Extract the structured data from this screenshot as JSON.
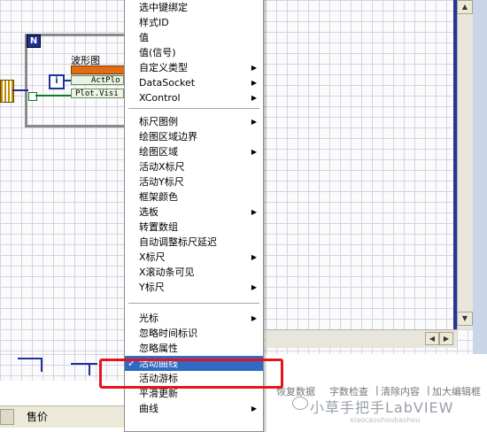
{
  "diagram": {
    "structure_label": "N",
    "waveform_label": "波形图",
    "index_icon_label": "i",
    "property_active_plot": "ActPlo",
    "property_visible": "Plot.Visi"
  },
  "context_menu": {
    "items": [
      {
        "label": "选中键绑定",
        "submenu": false,
        "checked": false,
        "highlighted": false
      },
      {
        "label": "样式ID",
        "submenu": false,
        "checked": false,
        "highlighted": false
      },
      {
        "label": "值",
        "submenu": false,
        "checked": false,
        "highlighted": false
      },
      {
        "label": "值(信号)",
        "submenu": false,
        "checked": false,
        "highlighted": false
      },
      {
        "label": "自定义类型",
        "submenu": true,
        "checked": false,
        "highlighted": false
      },
      {
        "label": "DataSocket",
        "submenu": true,
        "checked": false,
        "highlighted": false
      },
      {
        "label": "XControl",
        "submenu": true,
        "checked": false,
        "highlighted": false
      },
      {
        "label": "标尺图例",
        "submenu": true,
        "checked": false,
        "highlighted": false
      },
      {
        "label": "绘图区域边界",
        "submenu": false,
        "checked": false,
        "highlighted": false
      },
      {
        "label": "绘图区域",
        "submenu": true,
        "checked": false,
        "highlighted": false
      },
      {
        "label": "活动X标尺",
        "submenu": false,
        "checked": false,
        "highlighted": false
      },
      {
        "label": "活动Y标尺",
        "submenu": false,
        "checked": false,
        "highlighted": false
      },
      {
        "label": "框架颜色",
        "submenu": false,
        "checked": false,
        "highlighted": false
      },
      {
        "label": "选板",
        "submenu": true,
        "checked": false,
        "highlighted": false
      },
      {
        "label": "转置数组",
        "submenu": false,
        "checked": false,
        "highlighted": false
      },
      {
        "label": "自动调整标尺延迟",
        "submenu": false,
        "checked": false,
        "highlighted": false
      },
      {
        "label": "X标尺",
        "submenu": true,
        "checked": false,
        "highlighted": false
      },
      {
        "label": "X滚动条可见",
        "submenu": false,
        "checked": false,
        "highlighted": false
      },
      {
        "label": "Y标尺",
        "submenu": true,
        "checked": false,
        "highlighted": false
      },
      {
        "label": "光标",
        "submenu": true,
        "checked": false,
        "highlighted": false
      },
      {
        "label": "忽略时间标识",
        "submenu": false,
        "checked": false,
        "highlighted": false
      },
      {
        "label": "忽略属性",
        "submenu": false,
        "checked": false,
        "highlighted": false
      },
      {
        "label": "活动曲线",
        "submenu": false,
        "checked": true,
        "highlighted": true
      },
      {
        "label": "活动游标",
        "submenu": false,
        "checked": false,
        "highlighted": false
      },
      {
        "label": "平滑更新",
        "submenu": false,
        "checked": false,
        "highlighted": false
      },
      {
        "label": "曲线",
        "submenu": true,
        "checked": false,
        "highlighted": false
      }
    ],
    "arrow_glyph": "▶",
    "check_glyph": "✓"
  },
  "bottom": {
    "status_label": "售价",
    "toolbar_items": [
      "恢复数据",
      "字数检查",
      "清除内容",
      "加大编辑框"
    ],
    "toolbar_separator": "|"
  },
  "watermark": {
    "text": "小草手把手LabVIEW",
    "subtext": "xiaocaoshoubashou"
  },
  "scrollbar": {
    "up_glyph": "▲",
    "down_glyph": "▼",
    "left_glyph": "◀",
    "right_glyph": "▶"
  },
  "colors": {
    "menu_highlight": "#316ac5",
    "callout_red": "#e4141b",
    "window_border": "#26349a"
  }
}
